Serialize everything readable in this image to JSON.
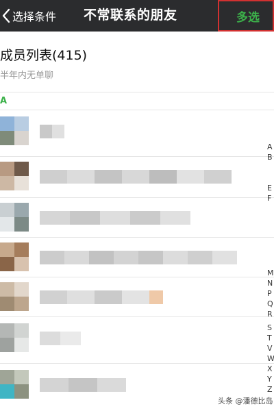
{
  "header": {
    "back_label": "选择条件",
    "title": "不常联系的朋友",
    "multi_select_label": "多选"
  },
  "group": {
    "title": "成员列表(415)",
    "subtitle": "半年内无单聊"
  },
  "section_letter": "A",
  "index_letters": [
    "A",
    "B",
    "E",
    "F",
    "M",
    "N",
    "P",
    "Q",
    "R",
    "S",
    "T",
    "V",
    "W",
    "X",
    "Y",
    "Z"
  ],
  "watermark": "头条 @潘德比岛",
  "colors": {
    "topbar_bg": "#2b2c2e",
    "accent_green": "#3cb14a",
    "highlight_red": "#d23131"
  }
}
